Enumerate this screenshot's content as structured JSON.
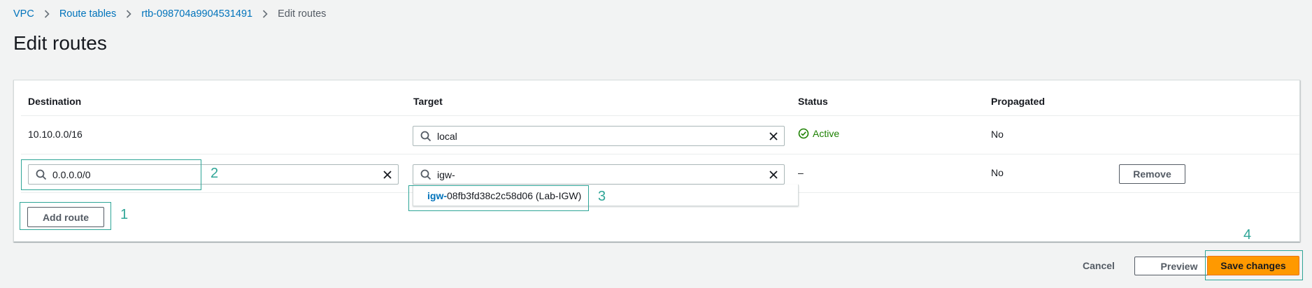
{
  "breadcrumb": {
    "items": [
      "VPC",
      "Route tables",
      "rtb-098704a9904531491"
    ],
    "current": "Edit routes"
  },
  "page": {
    "title": "Edit routes"
  },
  "table": {
    "headers": {
      "destination": "Destination",
      "target": "Target",
      "status": "Status",
      "propagated": "Propagated"
    },
    "rows": [
      {
        "destination": "10.10.0.0/16",
        "target": "local",
        "status": "Active",
        "propagated": "No"
      },
      {
        "destination": "0.0.0.0/0",
        "target": "igw-",
        "status": "–",
        "propagated": "No",
        "remove_label": "Remove"
      }
    ]
  },
  "dropdown": {
    "match": "igw-",
    "rest": "08fb3fd38c2c58d06 (Lab-IGW)"
  },
  "buttons": {
    "add_route": "Add route",
    "cancel": "Cancel",
    "preview": "Preview",
    "save": "Save changes"
  },
  "annotations": [
    "1",
    "2",
    "3",
    "4"
  ],
  "colors": {
    "accent": "#ff9900",
    "link": "#0073bb",
    "success": "#1d8102",
    "annotation": "#2ea597"
  }
}
